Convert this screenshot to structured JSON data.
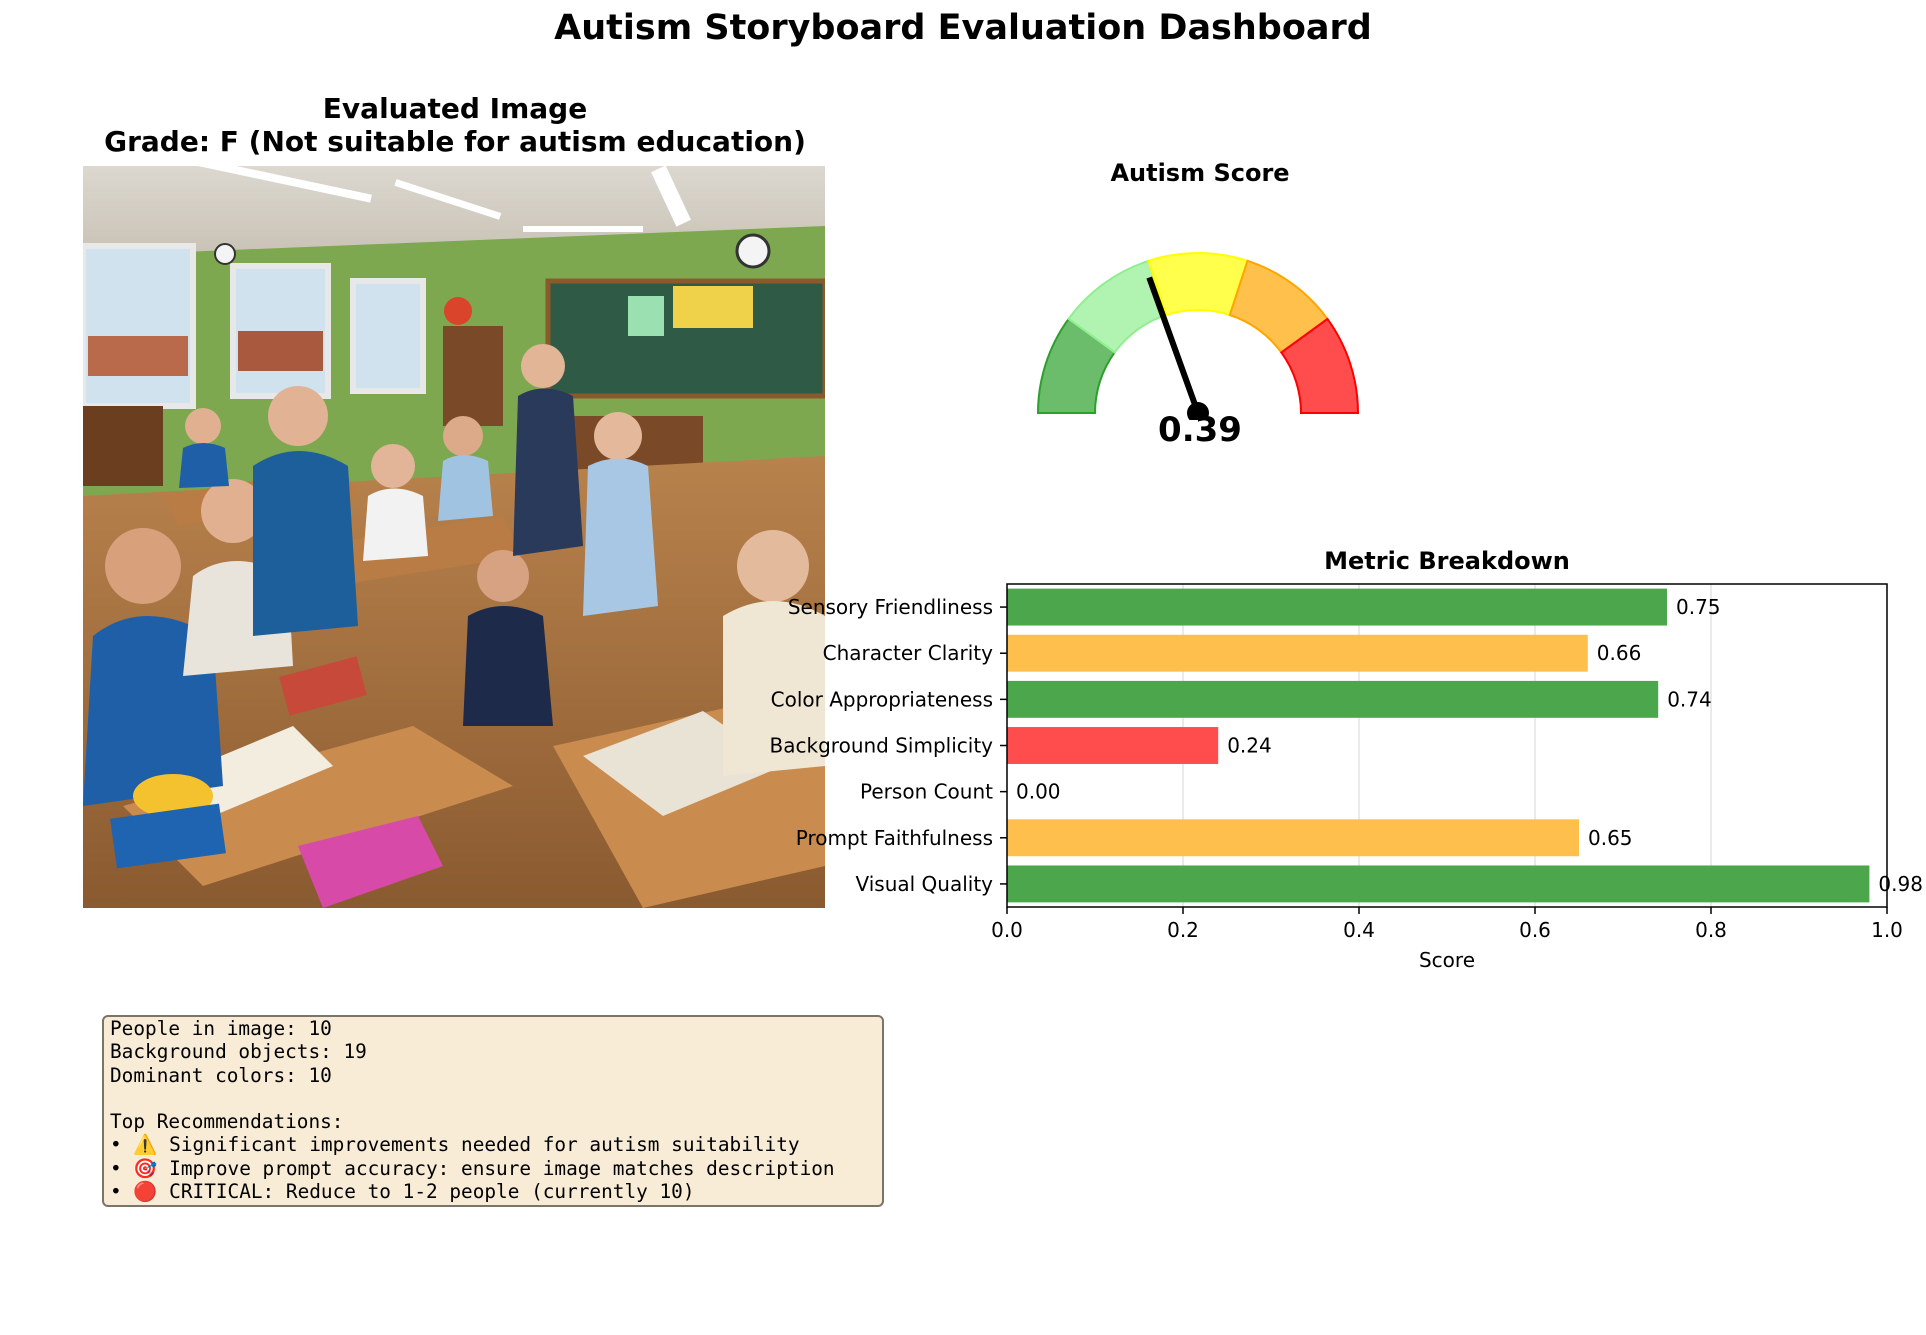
{
  "title": "Autism Storyboard Evaluation Dashboard",
  "image_panel": {
    "title_line1": "Evaluated Image",
    "title_line2": "Grade: F (Not suitable for autism education)"
  },
  "gauge": {
    "title": "Autism Score",
    "value": 0.39,
    "value_label": "0.39",
    "zones": [
      {
        "from": 0.0,
        "to": 0.2,
        "color": "#2ca02c"
      },
      {
        "from": 0.2,
        "to": 0.4,
        "color": "#90ee90"
      },
      {
        "from": 0.4,
        "to": 0.6,
        "color": "#ffff00"
      },
      {
        "from": 0.6,
        "to": 0.8,
        "color": "#ffa500"
      },
      {
        "from": 0.8,
        "to": 1.0,
        "color": "#ff0000"
      }
    ]
  },
  "chart_data": {
    "type": "bar",
    "orientation": "horizontal",
    "title": "Metric Breakdown",
    "xlabel": "Score",
    "ylabel": "",
    "xlim": [
      0,
      1.0
    ],
    "xticks": [
      "0.0",
      "0.2",
      "0.4",
      "0.6",
      "0.8",
      "1.0"
    ],
    "grid": "vertical",
    "categories": [
      "Sensory Friendliness",
      "Character Clarity",
      "Color Appropriateness",
      "Background Simplicity",
      "Person Count",
      "Prompt Faithfulness",
      "Visual Quality"
    ],
    "values": [
      0.75,
      0.66,
      0.74,
      0.24,
      0.0,
      0.65,
      0.98
    ],
    "value_labels": [
      "0.75",
      "0.66",
      "0.74",
      "0.24",
      "0.00",
      "0.65",
      "0.98"
    ],
    "colors": [
      "#4ca64c",
      "#ffbf4c",
      "#4ca64c",
      "#ff4c4c",
      "#ff4c4c",
      "#ffbf4c",
      "#4ca64c"
    ]
  },
  "info": {
    "lines": [
      "People in image: 10",
      "Background objects: 19",
      "Dominant colors: 10",
      "",
      "Top Recommendations:",
      "• ⚠️ Significant improvements needed for autism suitability",
      "• 🎯 Improve prompt accuracy: ensure image matches description",
      "• 🔴 CRITICAL: Reduce to 1-2 people (currently 10)"
    ]
  }
}
